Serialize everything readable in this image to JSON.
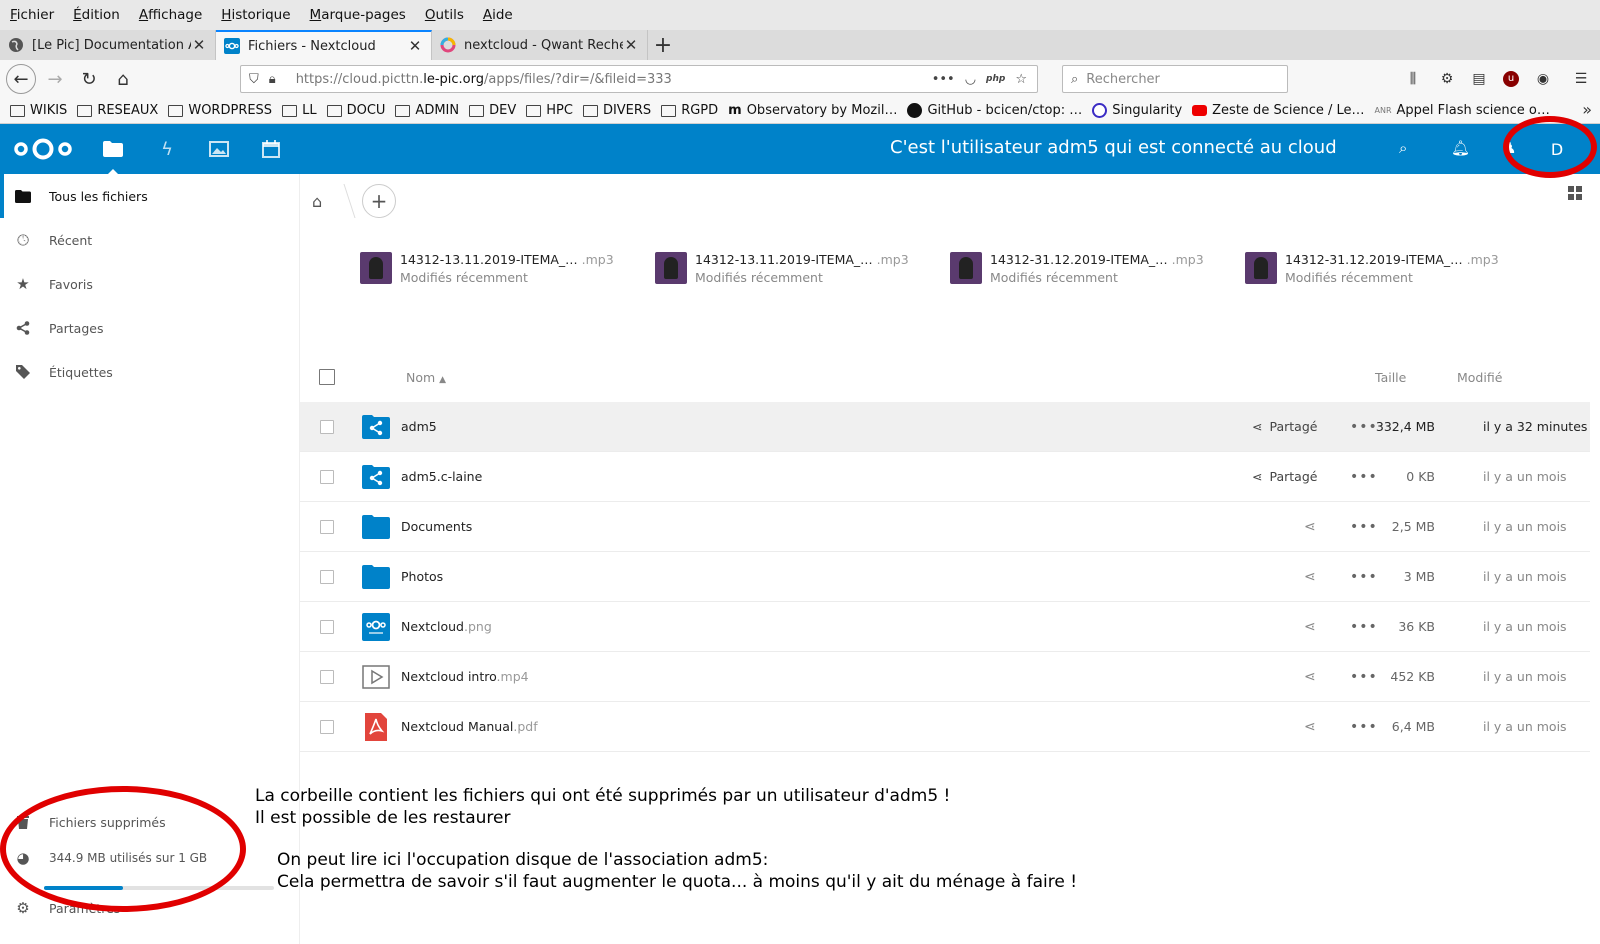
{
  "browser": {
    "menu": [
      "Fichier",
      "Édition",
      "Affichage",
      "Historique",
      "Marque-pages",
      "Outils",
      "Aide"
    ],
    "tabs": [
      {
        "label": "[Le Pic] Documentation Adr"
      },
      {
        "label": "Fichiers - Nextcloud"
      },
      {
        "label": "nextcloud - Qwant Recherc"
      }
    ],
    "url_prefix": "https://cloud.picttn.",
    "url_domain": "le-pic.org",
    "url_path": "/apps/files/?dir=/&fileid=333",
    "search_placeholder": "Rechercher",
    "bookmarks": [
      {
        "label": "WIKIS"
      },
      {
        "label": "RESEAUX"
      },
      {
        "label": "WORDPRESS"
      },
      {
        "label": "LL"
      },
      {
        "label": "DOCU"
      },
      {
        "label": "ADMIN"
      },
      {
        "label": "DEV"
      },
      {
        "label": "HPC"
      },
      {
        "label": "DIVERS"
      },
      {
        "label": "RGPD"
      }
    ],
    "link_bookmarks": [
      {
        "label": "Observatory by Mozil…"
      },
      {
        "label": "GitHub - bcicen/ctop: …"
      },
      {
        "label": "Singularity"
      },
      {
        "label": "Zeste de Science / Le…"
      },
      {
        "label": "Appel Flash science o…"
      }
    ]
  },
  "nextcloud": {
    "header_title": "C'est l'utilisateur adm5 qui est connecté au cloud",
    "avatar_letter": "D",
    "sidebar": {
      "items": [
        {
          "label": "Tous les fichiers"
        },
        {
          "label": "Récent"
        },
        {
          "label": "Favoris"
        },
        {
          "label": "Partages"
        },
        {
          "label": "Étiquettes"
        }
      ],
      "trash": "Fichiers supprimés",
      "quota": "344.9 MB utilisés sur 1 GB",
      "quota_fraction": 0.345,
      "settings": "Paramètres"
    },
    "recent": [
      {
        "name": "14312-13.11.2019-ITEMA_…",
        "ext": ".mp3",
        "sub": "Modifiés récemment"
      },
      {
        "name": "14312-13.11.2019-ITEMA_…",
        "ext": ".mp3",
        "sub": "Modifiés récemment"
      },
      {
        "name": "14312-31.12.2019-ITEMA_…",
        "ext": ".mp3",
        "sub": "Modifiés récemment"
      },
      {
        "name": "14312-31.12.2019-ITEMA_…",
        "ext": ".mp3",
        "sub": "Modifiés récemment"
      }
    ],
    "columns": {
      "name": "Nom",
      "size": "Taille",
      "modified": "Modifié"
    },
    "share_label": "Partagé",
    "files": [
      {
        "name": "adm5",
        "ext": "",
        "size": "332,4 MB",
        "modified": "il y a 32 minutes"
      },
      {
        "name": "adm5.c-laine",
        "ext": "",
        "size": "0 KB",
        "modified": "il y a un mois"
      },
      {
        "name": "Documents",
        "ext": "",
        "size": "2,5 MB",
        "modified": "il y a un mois"
      },
      {
        "name": "Photos",
        "ext": "",
        "size": "3 MB",
        "modified": "il y a un mois"
      },
      {
        "name": "Nextcloud",
        "ext": ".png",
        "size": "36 KB",
        "modified": "il y a un mois"
      },
      {
        "name": "Nextcloud intro",
        "ext": ".mp4",
        "size": "452 KB",
        "modified": "il y a un mois"
      },
      {
        "name": "Nextcloud Manual",
        "ext": ".pdf",
        "size": "6,4 MB",
        "modified": "il y a un mois"
      }
    ]
  },
  "annotations": {
    "line1": "La corbeille contient les fichiers qui ont été supprimés par un utilisateur d'adm5 !",
    "line2": "Il est possible de les restaurer",
    "line3": "On peut lire ici l'occupation disque de l'association adm5:",
    "line4": "Cela permettra de savoir s'il faut augmenter le quota... à moins qu'il y ait du ménage à faire !"
  },
  "colors": {
    "brand": "#0082c9",
    "annotation": "#e00000"
  }
}
